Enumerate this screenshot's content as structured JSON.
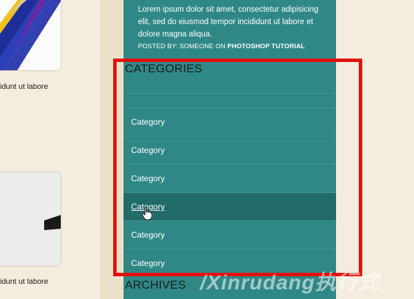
{
  "content": {
    "excerpts": [
      "idunt ut labore",
      "idunt ut labore"
    ],
    "images": [
      "pencils-image",
      "product-image"
    ]
  },
  "sidebar": {
    "post": {
      "text": "Lorem ipsum dolor sit amet, consectetur adipisicing elit, sed do eiusmod tempor incididunt ut labore et dolore magna aliqua.",
      "meta_prefix": "POSTED BY: SOMEONE ON ",
      "meta_category": "PHOTOSHOP TUTORIAL"
    },
    "categories_title": "CATEGORIES",
    "categories": [
      "Category",
      "Category",
      "Category",
      "Category",
      "Category",
      "Category"
    ],
    "hovered_index": 3,
    "archives_title": "ARCHIVES"
  },
  "colors": {
    "sidebar": "#2f8886",
    "hover_row": "#236b69",
    "highlight": "#e3100e",
    "page_background": "#f4ecdc"
  },
  "watermark": "/Xinrudang执行式"
}
